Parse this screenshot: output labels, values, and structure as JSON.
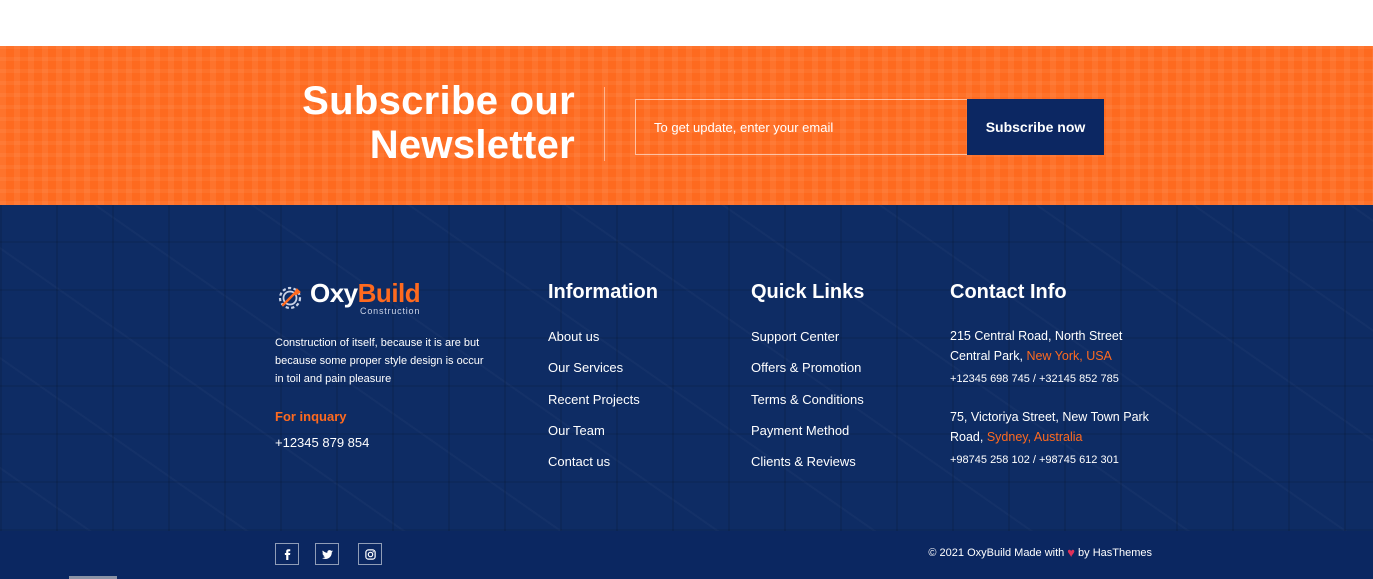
{
  "newsletter": {
    "title_line1": "Subscribe our",
    "title_line2": "Newsletter",
    "email_placeholder": "To get update, enter your email",
    "button_label": "Subscribe now"
  },
  "brand": {
    "logo_part1": "Oxy",
    "logo_part2": "Build",
    "logo_subtitle": "Construction",
    "description": "Construction of itself, because it is are but because some proper style design is occur in toil and pain pleasure",
    "inquiry_label": "For inquary",
    "inquiry_phone": "+12345 879 854"
  },
  "information": {
    "title": "Information",
    "links": [
      "About us",
      "Our Services",
      "Recent Projects",
      "Our Team",
      "Contact us"
    ]
  },
  "quick_links": {
    "title": "Quick Links",
    "links": [
      "Support Center",
      "Offers & Promotion",
      "Terms & Conditions",
      "Payment Method",
      "Clients & Reviews"
    ]
  },
  "contact": {
    "title": "Contact Info",
    "addresses": [
      {
        "line1": "215 Central Road, North Street",
        "line2_prefix": "Central Park,",
        "line2_highlight": "New York, USA",
        "phones": "+12345 698 745 / +32145 852 785"
      },
      {
        "line1": "75, Victoriya Street, New Town Park",
        "line2_prefix": "Road,",
        "line2_highlight": "Sydney, Australia",
        "phones": "+98745 258 102 / +98745 612 301"
      }
    ]
  },
  "footer_bottom": {
    "social_icons": [
      "facebook-icon",
      "twitter-icon",
      "instagram-icon"
    ],
    "copyright_prefix": "© 2021 OxyBuild Made with",
    "copyright_suffix": "by HasThemes"
  },
  "colors": {
    "accent_orange": "#fe6a1f",
    "navy": "#0e2c64",
    "button_navy": "#0c2762",
    "heart": "#e0315a"
  }
}
